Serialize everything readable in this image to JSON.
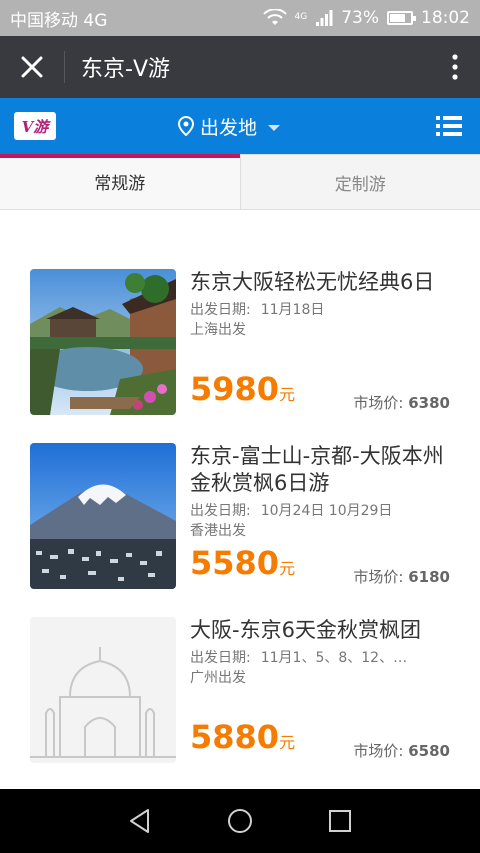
{
  "status_bar": {
    "carrier": "中国移动 4G",
    "signal_tag": "4G",
    "battery": "73%",
    "battery_level": 0.73,
    "time": "18:02"
  },
  "title_bar": {
    "title": "东京-V游"
  },
  "nav": {
    "logo_text": "V游",
    "departure_label": "出发地"
  },
  "tabs": [
    {
      "label": "常规游",
      "active": true
    },
    {
      "label": "定制游",
      "active": false
    }
  ],
  "products": [
    {
      "title": "东京大阪轻松无忧经典6日",
      "date_label": "出发日期:",
      "dates": "11月18日",
      "origin": "上海出发",
      "price": "5980",
      "unit": "元",
      "market_label": "市场价:",
      "market_price": "6380"
    },
    {
      "title": "东京-富士山-京都-大阪本州金秋赏枫6日游",
      "date_label": "出发日期:",
      "dates": "10月24日 10月29日",
      "origin": "香港出发",
      "price": "5580",
      "unit": "元",
      "market_label": "市场价:",
      "market_price": "6180"
    },
    {
      "title": "大阪-东京6天金秋赏枫团",
      "date_label": "出发日期:",
      "dates": "11月1、5、8、12、1...",
      "origin": "广州出发",
      "price": "5880",
      "unit": "元",
      "market_label": "市场价:",
      "market_price": "6580"
    }
  ],
  "colors": {
    "nav_blue": "#0b7fdc",
    "title_bar": "#393a3f",
    "price_orange": "#f57c00",
    "tab_accent": "#c2185b"
  }
}
